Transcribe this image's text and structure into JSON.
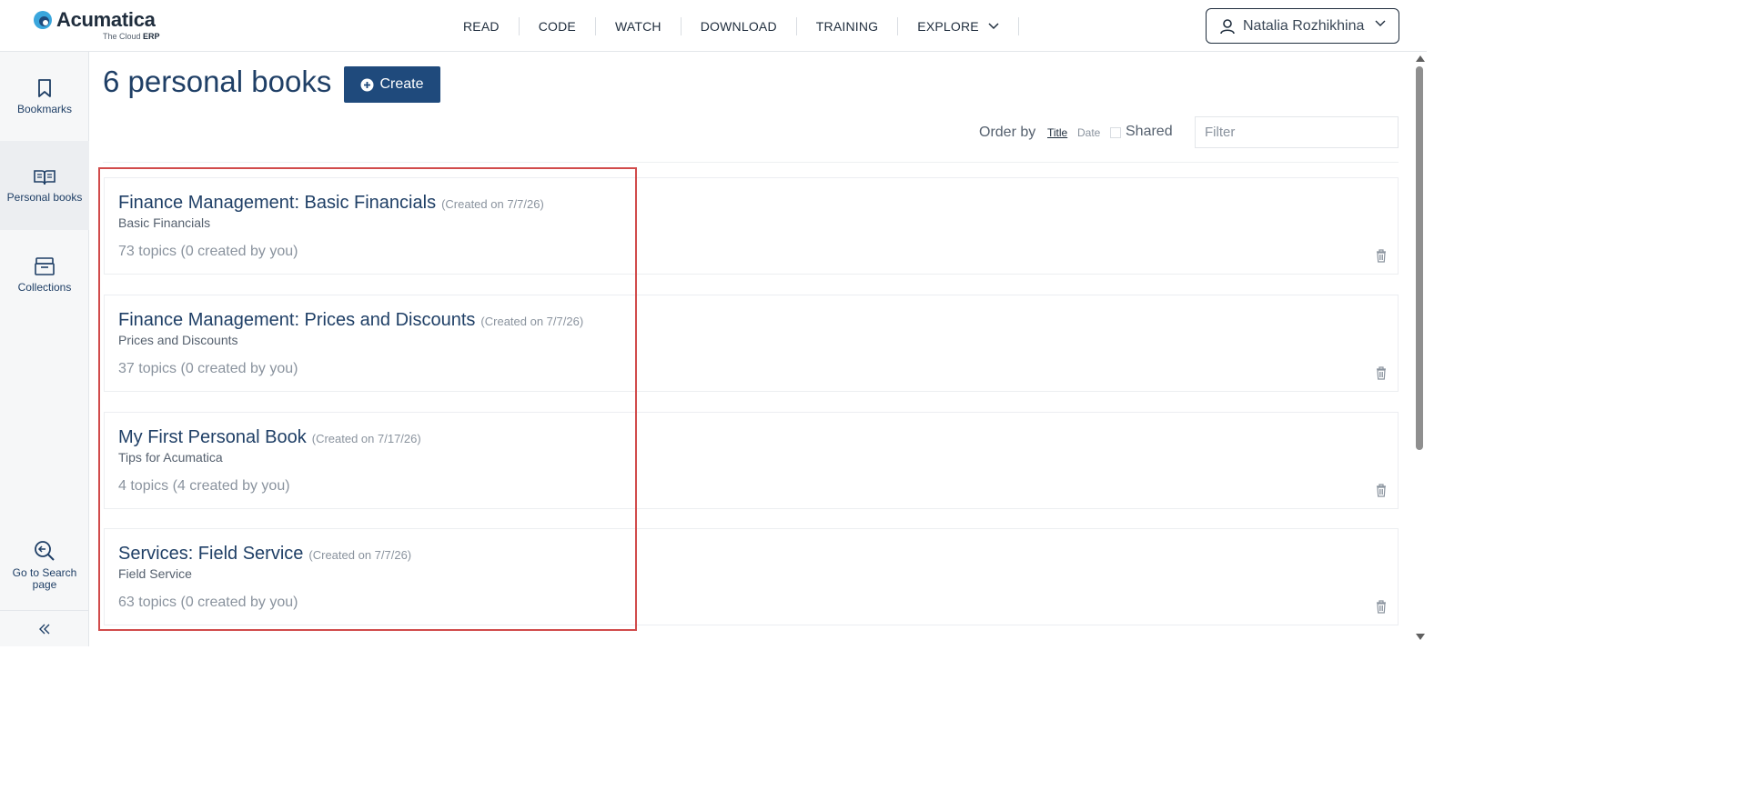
{
  "header": {
    "logo_name": "Acumatica",
    "logo_tagline_prefix": "The Cloud ",
    "logo_tagline_bold": "ERP",
    "nav": [
      "READ",
      "CODE",
      "WATCH",
      "DOWNLOAD",
      "TRAINING",
      "EXPLORE"
    ],
    "user_name": "Natalia Rozhikhina"
  },
  "sidebar": {
    "items": [
      {
        "label": "Bookmarks",
        "icon": "bookmark-icon"
      },
      {
        "label": "Personal books",
        "icon": "book-icon"
      },
      {
        "label": "Collections",
        "icon": "archive-icon"
      },
      {
        "label": "Go to Search page",
        "icon": "search-back-icon"
      }
    ],
    "collapse_icon": "double-chevron-left-icon"
  },
  "main": {
    "title": "6 personal books",
    "create_label": "Create",
    "order_by_label": "Order by",
    "order_options": [
      "Title",
      "Date"
    ],
    "shared_label": "Shared",
    "filter_placeholder": "Filter",
    "books": [
      {
        "title": "Finance Management: Basic Financials",
        "created": "(Created on 7/7/26)",
        "subtitle": "Basic Financials",
        "topics": "73 topics (0 created by you)"
      },
      {
        "title": "Finance Management: Prices and Discounts",
        "created": "(Created on 7/7/26)",
        "subtitle": "Prices and Discounts",
        "topics": "37 topics (0 created by you)"
      },
      {
        "title": "My First Personal Book",
        "created": "(Created on 7/17/26)",
        "subtitle": "Tips for Acumatica",
        "topics": "4 topics (4 created by you)"
      },
      {
        "title": "Services: Field Service",
        "created": "(Created on 7/7/26)",
        "subtitle": "Field Service",
        "topics": "63 topics (0 created by you)"
      }
    ]
  },
  "colors": {
    "brand_blue": "#1f4a7c",
    "title_blue": "#1f3f66",
    "highlight_red": "#d14b4b",
    "logo_cyan": "#3aa6dd"
  }
}
